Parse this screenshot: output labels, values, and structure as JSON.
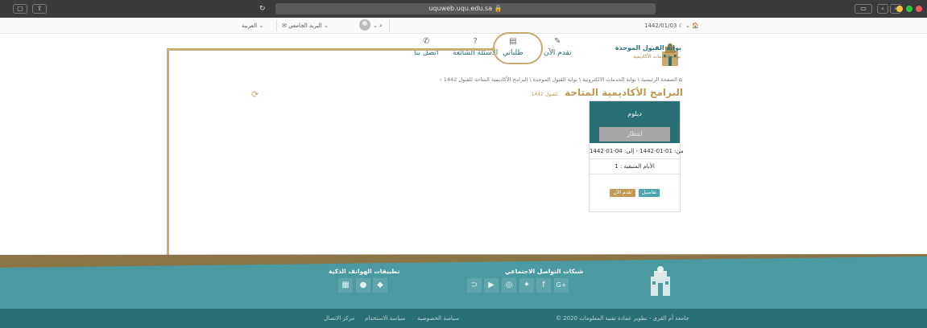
{
  "browser": {
    "url": "uquweb.uqu.edu.sa 🔒",
    "traffic_colors": [
      "#f6c343",
      "#2bc840",
      "#f05a55"
    ]
  },
  "utility": {
    "date": "1442/01/03 ☾ ⌄ 🏠",
    "language": "العربية ⌄",
    "email": "البريد الجامعي ⌄",
    "user": "⌄",
    "search_icon": "🔍"
  },
  "brand": {
    "title": "بوابة القبول الموحدة",
    "subtitle": "بوابة الخدمات الأكاديمية"
  },
  "nav": [
    {
      "label": "تقدم الآن",
      "icon": "edit-icon"
    },
    {
      "label": "طلباتي",
      "icon": "list-icon"
    },
    {
      "label": "الأسئلة الشائعة",
      "icon": "question-icon"
    },
    {
      "label": "اتصل بنا",
      "icon": "phone-icon"
    }
  ],
  "breadcrumb": {
    "home_icon": "🏠",
    "path": "الصفحة الرئيسية \\ بوابة الخدمات الالكترونية \\ بوابة القبول الموحدة \\ البرامج الأكاديمية المتاحة للقبول 1442",
    "arrow": "‹"
  },
  "page": {
    "title": "البرامج الأكاديمية المتاحة",
    "title_sub": "للقبول 1442"
  },
  "card": {
    "title": "دبلوم",
    "status": "انتظار",
    "dates": "من: 01-01-1442 - إلى: 04-01-1442",
    "remaining": "الأيام المتبقية : 1",
    "details_btn": "تفاصيل",
    "apply_btn": "تقدم الآن"
  },
  "footer": {
    "social_title": "شبكات التواصل الاجتماعي",
    "apps_title": "تطبيقات الهواتف الذكية",
    "social_icons": [
      "G+",
      "f",
      "🐦",
      "◎",
      "▶",
      "⊃"
    ],
    "app_icons": [
      "◆",
      "",
      "▦"
    ],
    "copyright": "© 2020 جامعة أم القرى - تطوير عمادة تقنية المعلومات",
    "links": [
      "سياسة الخصوصية",
      "سياسة الاستخدام",
      "مركز الاتصال"
    ]
  },
  "colors": {
    "teal": "#2a6f76",
    "teal_light": "#4b9aa1",
    "gold": "#c9a96e",
    "brown": "#8a7547"
  }
}
